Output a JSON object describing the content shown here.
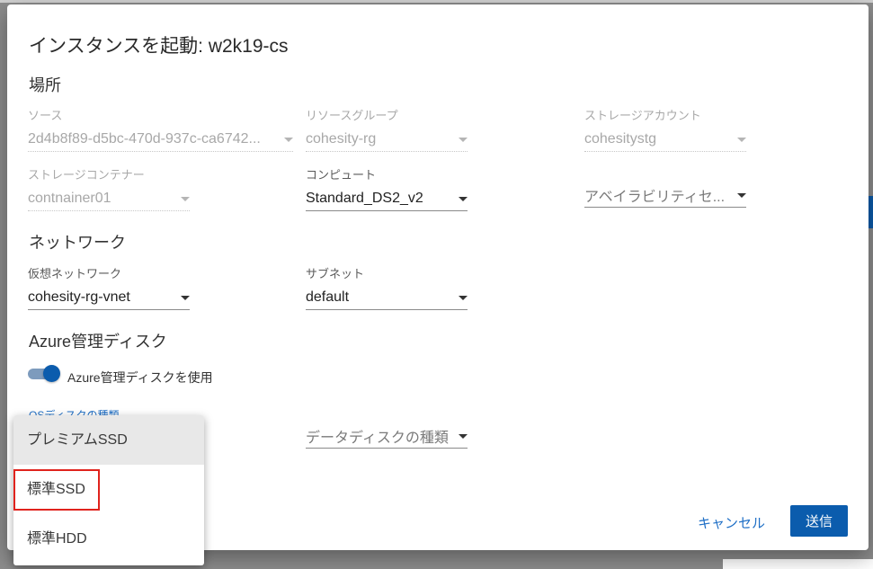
{
  "dialog": {
    "title": "インスタンスを起動: w2k19-cs",
    "sections": {
      "location": "場所",
      "network": "ネットワーク",
      "managed_disk": "Azure管理ディスク"
    },
    "fields": {
      "source": {
        "label": "ソース",
        "value": "2d4b8f89-d5bc-470d-937c-ca6742..."
      },
      "resource_group": {
        "label": "リソースグループ",
        "value": "cohesity-rg"
      },
      "storage_account": {
        "label": "ストレージアカウント",
        "value": "cohesitystg"
      },
      "storage_container": {
        "label": "ストレージコンテナー",
        "value": "contnainer01"
      },
      "compute": {
        "label": "コンピュート",
        "value": "Standard_DS2_v2"
      },
      "availability_set": {
        "placeholder": "アベイラビリティセ..."
      },
      "virtual_network": {
        "label": "仮想ネットワーク",
        "value": "cohesity-rg-vnet"
      },
      "subnet": {
        "label": "サブネット",
        "value": "default"
      },
      "os_disk_type": {
        "label": "OSディスクの種類"
      },
      "data_disk_type": {
        "placeholder": "データディスクの種類"
      }
    },
    "toggle": {
      "label": "Azure管理ディスクを使用",
      "on": true
    },
    "buttons": {
      "cancel": "キャンセル",
      "submit": "送信"
    }
  },
  "dropdown_menu": {
    "items": [
      "プレミアムSSD",
      "標準SSD",
      "標準HDD"
    ],
    "hovered_index": 0,
    "highlighted_index": 1
  },
  "colors": {
    "accent": "#0b5cad",
    "link": "#1f6fc6",
    "highlight_box": "#e0231d"
  }
}
